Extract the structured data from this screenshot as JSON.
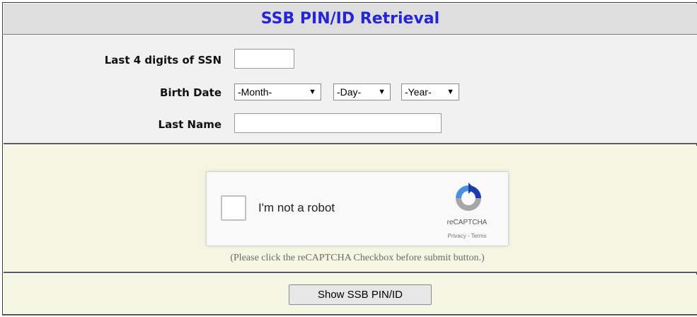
{
  "title": "SSB PIN/ID Retrieval",
  "form": {
    "ssn_label": "Last 4 digits of SSN",
    "ssn_value": "",
    "birth_label": "Birth Date",
    "month_selected": "-Month-",
    "day_selected": "-Day-",
    "year_selected": "-Year-",
    "lastname_label": "Last Name",
    "lastname_value": ""
  },
  "captcha": {
    "checkbox_label": "I'm not a robot",
    "brand": "reCAPTCHA",
    "links": "Privacy - Terms",
    "note": "(Please click the reCAPTCHA Checkbox before submit button.)"
  },
  "submit_label": "Show SSB PIN/ID",
  "colors": {
    "title": "#2424d8",
    "form_bg": "#f1f1f1",
    "captcha_bg": "#f4f6e3",
    "title_bg": "#dedede"
  }
}
